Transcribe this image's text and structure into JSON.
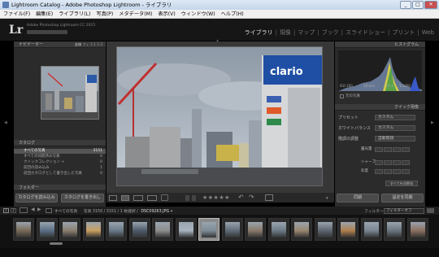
{
  "window": {
    "title": "Lightroom Catalog - Adobe Photoshop Lightroom - ライブラリ",
    "minimize": "_",
    "maximize": "□",
    "close": "✕"
  },
  "menu": [
    "ファイル(F)",
    "編集(E)",
    "ライブラリ(L)",
    "写真(P)",
    "メタデータ(M)",
    "表示(V)",
    "ウィンドウ(W)",
    "ヘルプ(H)"
  ],
  "identity": {
    "logo": "Lr",
    "line1": "Adobe Photoshop Lightroom CC 2015"
  },
  "modules": [
    "ライブラリ",
    "現像",
    "マップ",
    "ブック",
    "スライドショー",
    "プリント",
    "Web"
  ],
  "navigator": {
    "title": "ナビゲーター",
    "toggles": [
      "全体",
      "フィ",
      "1:1",
      "1:3"
    ]
  },
  "catalog": {
    "title": "カタログ",
    "rows": [
      {
        "label": "すべての写真",
        "count": "3151"
      },
      {
        "label": "すべての同期済み写真",
        "count": "0"
      },
      {
        "label": "クイックコレクション +",
        "count": "0"
      },
      {
        "label": "前回の読み込み",
        "count": "1"
      },
      {
        "label": "前回カタログとして書き出した写真",
        "count": "0"
      }
    ]
  },
  "folders": {
    "title": "フォルダー"
  },
  "left_buttons": {
    "import": "カタログを読み込み",
    "export": "カタログを書き出し"
  },
  "histogram": {
    "title": "ヒストグラム",
    "iso": "ISO 100",
    "focal": "18 mm",
    "fstop": "f/6.3",
    "shutter": "1/1000",
    "original": "元の写真"
  },
  "quick_develop": {
    "title": "クイック現像",
    "preset_label": "プリセット",
    "preset_value": "カスタム",
    "wb_label": "ホワイトバランス",
    "wb_value": "カスタム",
    "tone_label": "階調の調整",
    "tone_value": "自動階調",
    "exposure_label": "露光量",
    "sharp_label": "シャープ",
    "sat_label": "彩度",
    "reset_all": "すべてを初期化"
  },
  "right_buttons": {
    "sync": "同期",
    "sync_settings": "設定を同期"
  },
  "toolbar": {
    "stars": "★★★★★"
  },
  "filmstrip": {
    "source_label": "すべての写真",
    "info": "写真 3150 / 3151 / 1 枚選択 /",
    "filename": "DSC09263.JPG",
    "filter_label": "フィルター :",
    "filter_value": "フィルターオフ",
    "page_nums": [
      "1",
      "2"
    ]
  },
  "thumbs": [
    "#7a6a58",
    "#5a6f86",
    "#8a7f70",
    "#c9a060",
    "#6a7a8a",
    "#4d5a6b",
    "#8d8d8d",
    "#a9b4c2",
    "#7d8c99",
    "#5f6b78",
    "#8a7a6a",
    "#6c7b88",
    "#9a8770",
    "#5d6570",
    "#b08050",
    "#7a8592",
    "#6a7580",
    "#8c7060"
  ]
}
